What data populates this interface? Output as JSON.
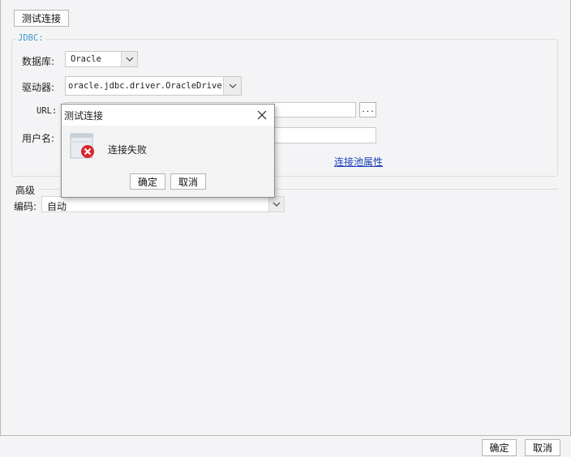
{
  "toolbar": {
    "test_connection_label": "测试连接"
  },
  "jdbc": {
    "legend": "JDBC:",
    "database_label": "数据库:",
    "database_value": "Oracle",
    "driver_label": "驱动器:",
    "driver_value": "oracle.jdbc.driver.OracleDriver",
    "url_label": "URL:",
    "url_value": "",
    "url_browse_label": "...",
    "username_label": "用户名:",
    "username_value": "",
    "pool_link": "连接池属性"
  },
  "advanced": {
    "title": "高级",
    "encoding_label": "编码:",
    "encoding_value": "自动"
  },
  "footer": {
    "ok_label": "确定",
    "cancel_label": "取消"
  },
  "dialog": {
    "title": "测试连接",
    "message": "连接失败",
    "ok_label": "确定",
    "cancel_label": "取消"
  },
  "colors": {
    "accent": "#3a9bc8",
    "link": "#1a3fb8",
    "error": "#d9252f"
  }
}
